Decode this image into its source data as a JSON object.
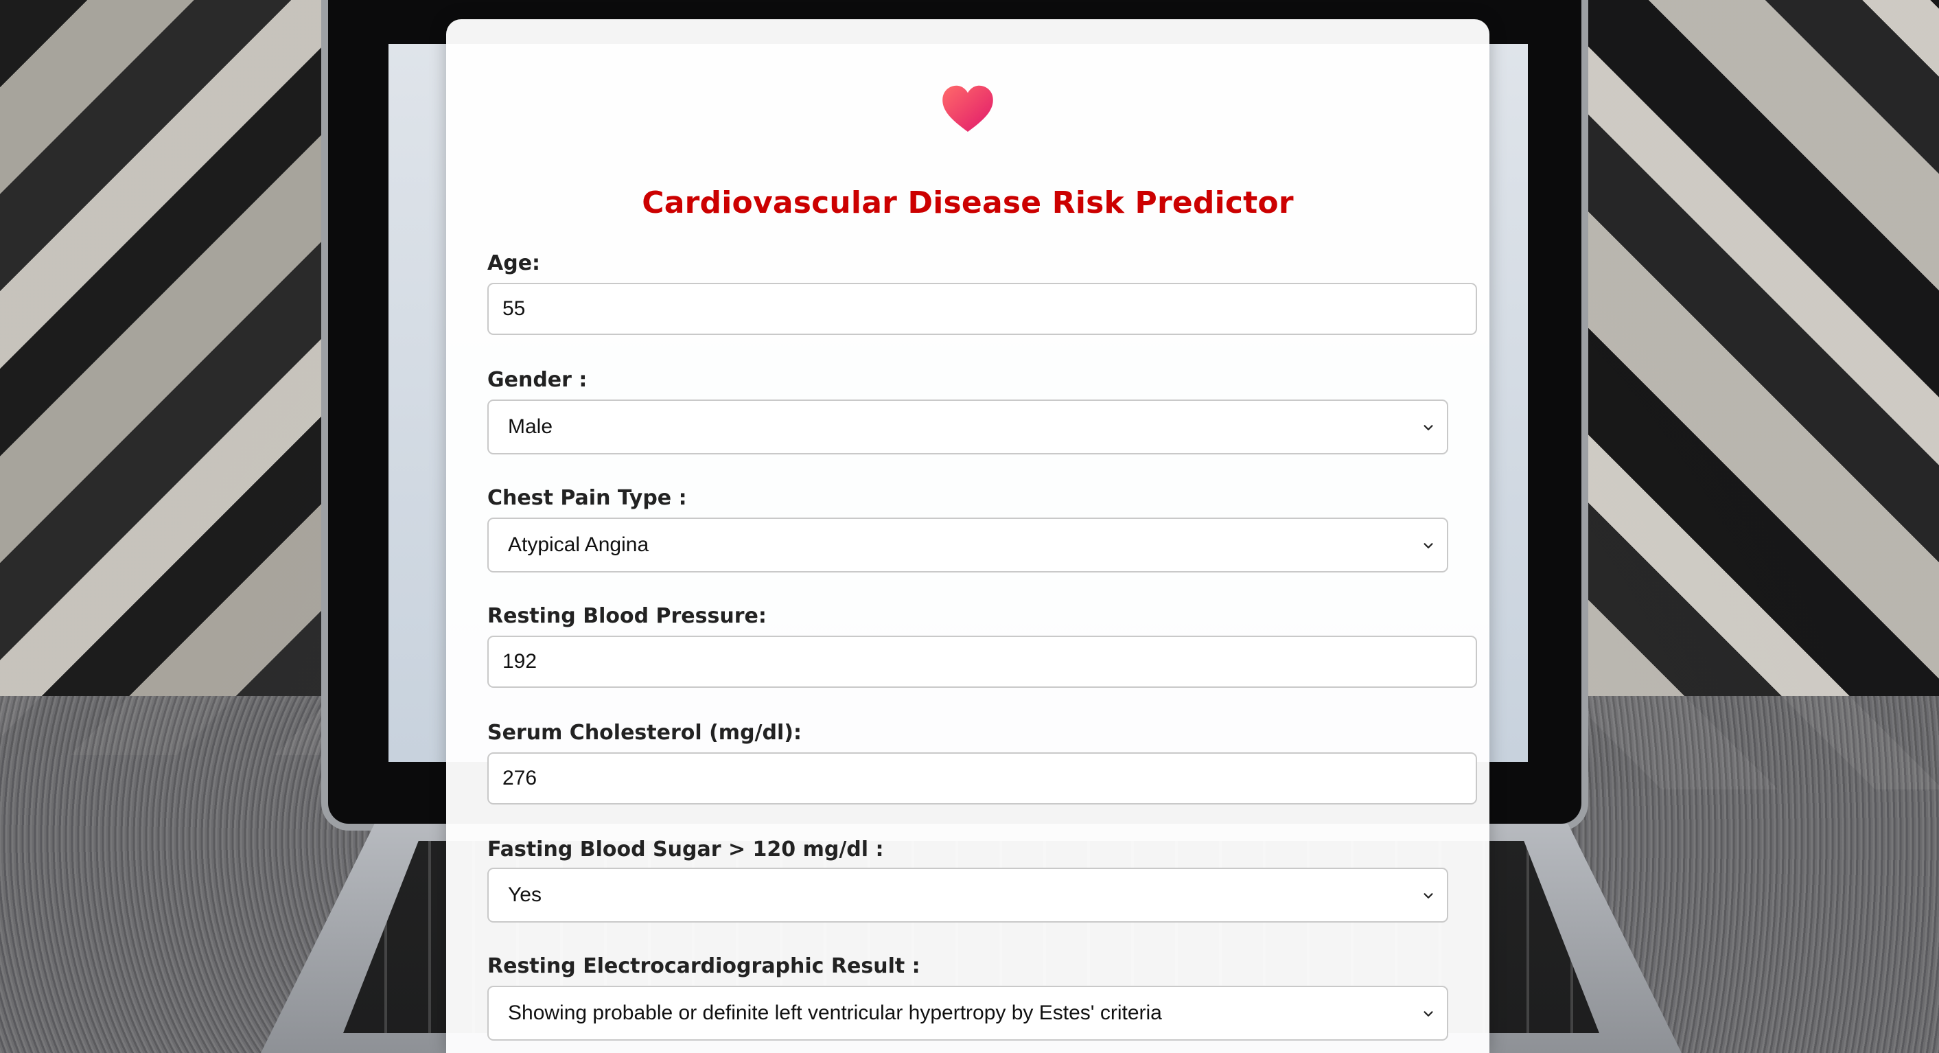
{
  "app": {
    "title": "Cardiovascular Disease Risk Predictor",
    "accent_color": "#cc0000",
    "icon": "heart-icon"
  },
  "fields": {
    "age": {
      "label": "Age:",
      "value": "55"
    },
    "gender": {
      "label": "Gender :",
      "value": "Male"
    },
    "chest_pain": {
      "label": "Chest Pain Type :",
      "value": "Atypical Angina"
    },
    "resting_bp": {
      "label": "Resting Blood Pressure:",
      "value": "192"
    },
    "cholesterol": {
      "label": "Serum Cholesterol (mg/dl):",
      "value": "276"
    },
    "fasting_sugar": {
      "label": "Fasting Blood Sugar > 120 mg/dl :",
      "value": "Yes"
    },
    "ecg": {
      "label": "Resting Electrocardiographic Result :",
      "value": "Showing probable or definite left ventricular hypertropy by Estes' criteria"
    }
  }
}
